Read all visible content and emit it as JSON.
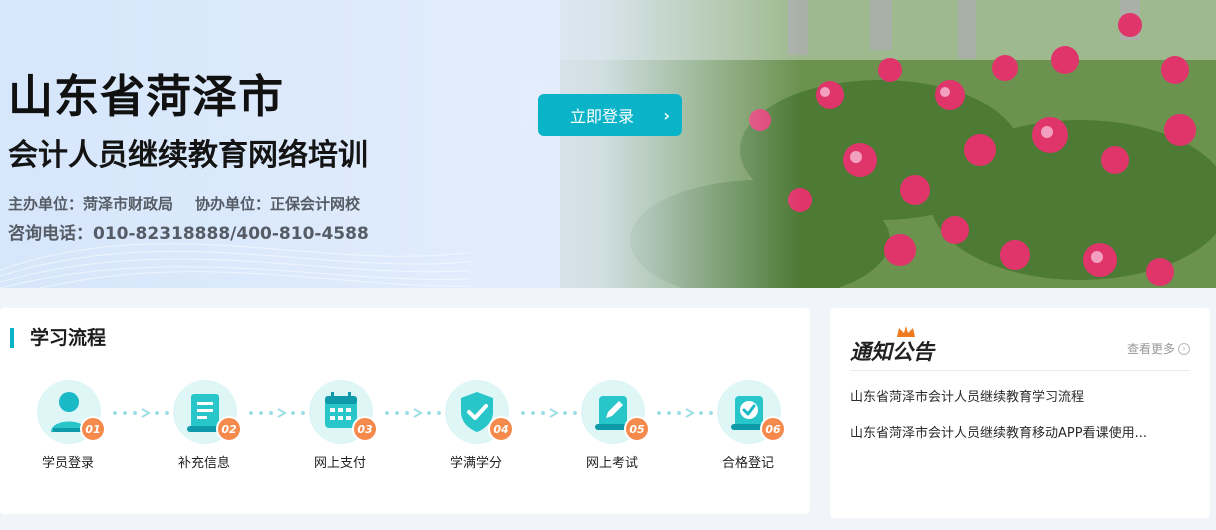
{
  "banner": {
    "title_main": "山东省菏泽市",
    "title_sub": "会计人员继续教育网络培训",
    "host": "主办单位：菏泽市财政局",
    "co_host": "协办单位：正保会计网校",
    "phone": "咨询电话：010-82318888/400-810-4588",
    "login_button": "立即登录",
    "login_arrow": "›"
  },
  "process": {
    "title": "学习流程",
    "steps": [
      {
        "number": "01",
        "label": "学员登录",
        "icon": "user-icon"
      },
      {
        "number": "02",
        "label": "补充信息",
        "icon": "document-icon"
      },
      {
        "number": "03",
        "label": "网上支付",
        "icon": "calendar-icon"
      },
      {
        "number": "04",
        "label": "学满学分",
        "icon": "shield-check-icon"
      },
      {
        "number": "05",
        "label": "网上考试",
        "icon": "exam-icon"
      },
      {
        "number": "06",
        "label": "合格登记",
        "icon": "certificate-icon"
      }
    ]
  },
  "notice": {
    "title": "通知公告",
    "more": "查看更多",
    "items": [
      "山东省菏泽市会计人员继续教育学习流程",
      "山东省菏泽市会计人员继续教育移动APP看课使用..."
    ]
  },
  "colors": {
    "accent": "#0bb3c9",
    "badge": "#f58a4c",
    "icon_bg": "#dff6f7"
  }
}
